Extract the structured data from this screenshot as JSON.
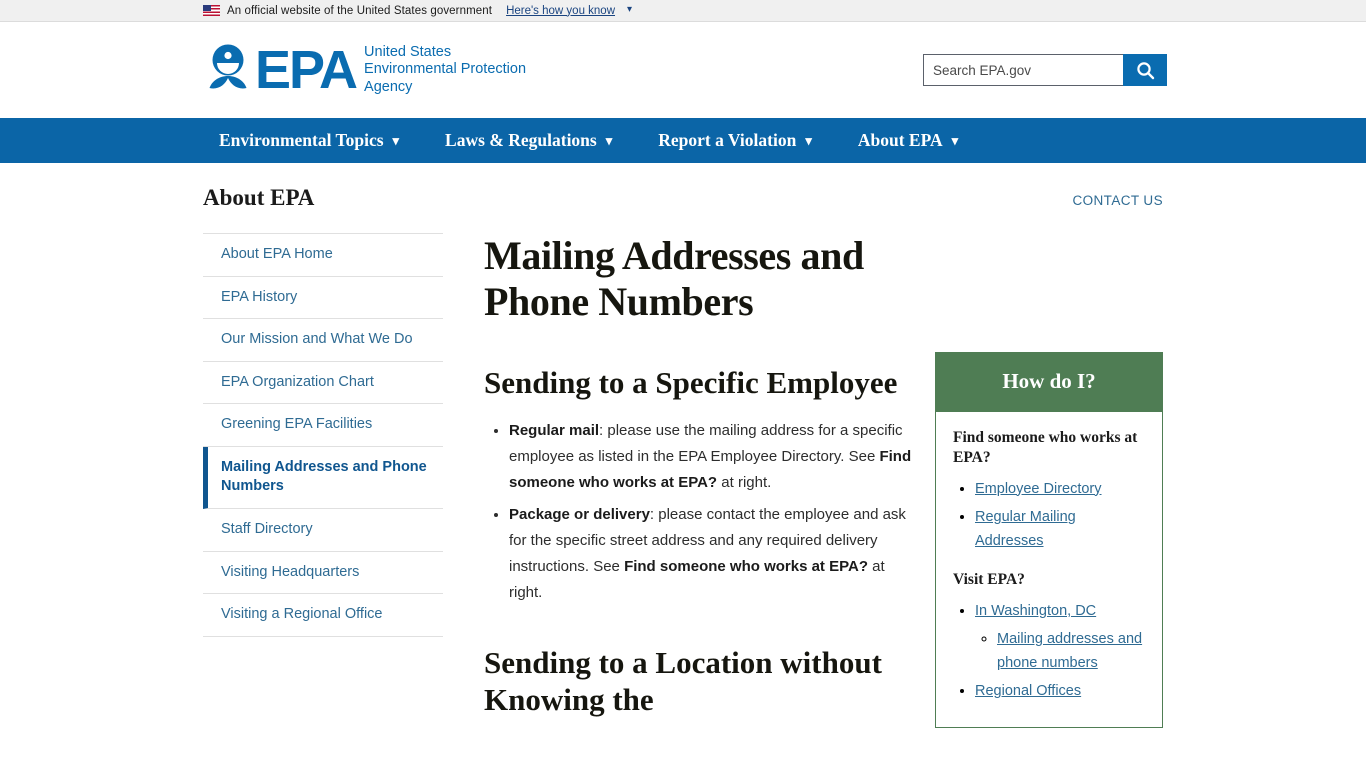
{
  "gov_banner": {
    "text": "An official website of the United States government",
    "link_label": "Here's how you know",
    "flag_icon": "us-flag-icon",
    "chevron_icon": "chevron-down-icon"
  },
  "header": {
    "logo_icon": "epa-seal-icon",
    "wordmark": "EPA",
    "agency_line1": "United States",
    "agency_line2": "Environmental Protection",
    "agency_line3": "Agency",
    "search": {
      "placeholder": "Search EPA.gov",
      "value": "",
      "button_icon": "search-icon"
    }
  },
  "main_nav": {
    "items": [
      {
        "label": "Environmental Topics",
        "chevron": "⌄"
      },
      {
        "label": "Laws & Regulations",
        "chevron": "⌄"
      },
      {
        "label": "Report a Violation",
        "chevron": "⌄"
      },
      {
        "label": "About EPA",
        "chevron": "⌄"
      }
    ]
  },
  "section": {
    "title": "About EPA",
    "contact_label": "CONTACT US"
  },
  "sidebar": {
    "items": [
      {
        "label": "About EPA Home",
        "active": false
      },
      {
        "label": "EPA History",
        "active": false
      },
      {
        "label": "Our Mission and What We Do",
        "active": false
      },
      {
        "label": "EPA Organization Chart",
        "active": false
      },
      {
        "label": "Greening EPA Facilities",
        "active": false
      },
      {
        "label": "Mailing Addresses and Phone Numbers",
        "active": true
      },
      {
        "label": "Staff Directory",
        "active": false
      },
      {
        "label": "Visiting Headquarters",
        "active": false
      },
      {
        "label": "Visiting a Regional Office",
        "active": false
      }
    ]
  },
  "main": {
    "page_title": "Mailing Addresses and Phone Numbers",
    "section1_heading": "Sending to a Specific Employee",
    "bullets": [
      {
        "lead": "Regular mail",
        "text_before": ": please use the mailing address for a specific employee as listed in the EPA Employee Directory. See ",
        "emphasis": "Find someone who works at EPA?",
        "text_after": " at right."
      },
      {
        "lead": "Package or delivery",
        "text_before": ": please contact the employee and ask for the specific street address and any required delivery instructions. See ",
        "emphasis": "Find someone who works at EPA?",
        "text_after": " at right."
      }
    ],
    "section2_heading": "Sending to a Location without Knowing the"
  },
  "howdoi": {
    "title": "How do I?",
    "group1_heading": "Find someone who works at EPA?",
    "group1_links": [
      "Employee Directory",
      "Regular Mailing Addresses"
    ],
    "group2_heading": "Visit EPA?",
    "group2_links": [
      "In Washington, DC",
      "Regional Offices"
    ],
    "group2_sublinks": [
      "Mailing addresses and phone numbers"
    ]
  },
  "colors": {
    "nav_blue": "#0b65a7",
    "logo_blue": "#0a6cb0",
    "green": "#4f7d54",
    "link_blue": "#2f6b93",
    "active_blue": "#10568f"
  }
}
